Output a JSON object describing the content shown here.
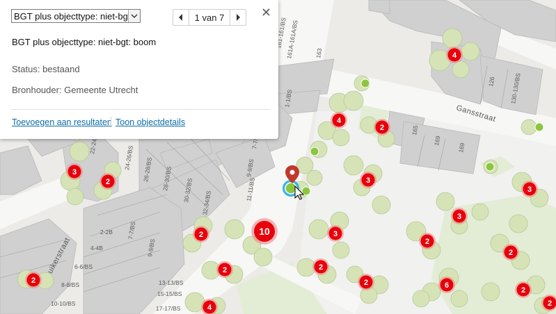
{
  "popup": {
    "layer_select_value": "BGT plus objecttype: niet-bgt",
    "pager": "1 van 7",
    "title": "BGT plus objecttype: niet-bgt: boom",
    "status": "Status: bestaand",
    "owner": "Bronhouder: Gemeente Utrecht",
    "link_add": "Toevoegen aan resultaten",
    "link_details": "Toon objectdetails"
  },
  "map": {
    "street_labels": [
      "Gansstraat",
      "Duikerstraat"
    ],
    "address_labels": [
      "161-161/BS",
      "161A-161A/BS",
      "163",
      "1-1/BS",
      "7-7/BS",
      "9-9/BS",
      "11-11/BS",
      "126",
      "130-130/BS",
      "165",
      "169",
      "169",
      "22-24/BS",
      "24-26/BS",
      "26-28/BS",
      "28-30/BS",
      "30-32/BS",
      "32-34/BS",
      "2-2B",
      "4-4B",
      "6-6/BS",
      "8-8/BS",
      "10-10/BS",
      "7-7/BS",
      "9-9/BS",
      "13-13/BS",
      "15-15/BS",
      "17-17/BS"
    ],
    "cluster_counts": [
      "4",
      "2",
      "4",
      "3",
      "2",
      "3",
      "2",
      "3",
      "10",
      "3",
      "3",
      "2",
      "2",
      "2",
      "2",
      "2",
      "2",
      "6",
      "2",
      "2",
      "4"
    ]
  },
  "colors": {
    "cluster_red": "#e8000b",
    "tree_green": "#d6e3b6",
    "building_grey": "#d0d0d0",
    "link_blue": "#0a6ca8"
  }
}
